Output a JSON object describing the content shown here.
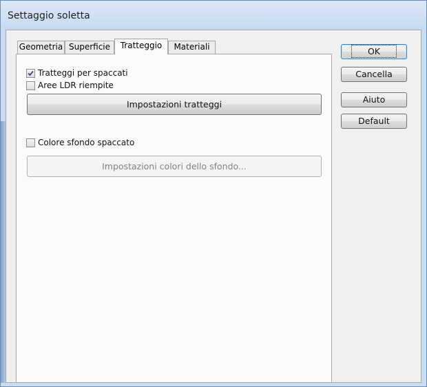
{
  "window": {
    "title": "Settaggio soletta"
  },
  "tabs": [
    {
      "label": "Geometria",
      "active": false
    },
    {
      "label": "Superficie",
      "active": false
    },
    {
      "label": "Tratteggio",
      "active": true
    },
    {
      "label": "Materiali",
      "active": false
    }
  ],
  "panel": {
    "checkboxes": [
      {
        "label": "Tratteggi per spaccati",
        "checked": true
      },
      {
        "label": "Aree LDR riempite",
        "checked": false
      },
      {
        "label": "Colore sfondo spaccato",
        "checked": false
      }
    ],
    "hatch_settings_button": "Impostazioni tratteggi",
    "background_colors_button": "Impostazioni colori dello sfondo...",
    "background_colors_enabled": false
  },
  "side_buttons": {
    "ok": "OK",
    "cancel": "Cancella",
    "help": "Aiuto",
    "default": "Default"
  },
  "colors": {
    "frame": "#c9dcf0",
    "client": "#f0f0f0",
    "check_tick": "#2a4f7e"
  },
  "icons": {
    "check_tick": "checkmark-icon"
  }
}
